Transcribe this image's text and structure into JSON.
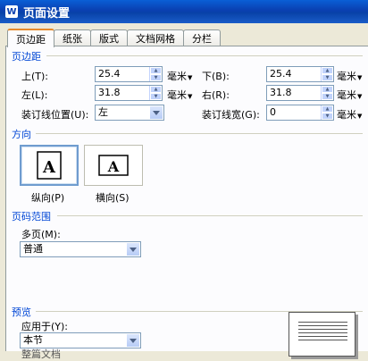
{
  "window": {
    "title": "页面设置",
    "icon_glyph": "W"
  },
  "tabs": [
    {
      "label": "页边距",
      "active": true
    },
    {
      "label": "纸张",
      "active": false
    },
    {
      "label": "版式",
      "active": false
    },
    {
      "label": "文档网格",
      "active": false
    },
    {
      "label": "分栏",
      "active": false
    }
  ],
  "margins": {
    "title": "页边距",
    "top_label": "上(T):",
    "top_value": "25.4",
    "bottom_label": "下(B):",
    "bottom_value": "25.4",
    "left_label": "左(L):",
    "left_value": "31.8",
    "right_label": "右(R):",
    "right_value": "31.8",
    "unit": "毫米",
    "gutter_pos_label": "装订线位置(U):",
    "gutter_pos_value": "左",
    "gutter_width_label": "装订线宽(G):",
    "gutter_width_value": "0"
  },
  "orientation": {
    "title": "方向",
    "icon_letter": "A",
    "portrait_label": "纵向(P)",
    "landscape_label": "横向(S)",
    "selected": "portrait"
  },
  "page_range": {
    "title": "页码范围",
    "multi_label": "多页(M):",
    "multi_value": "普通"
  },
  "preview": {
    "title": "预览",
    "apply_label": "应用于(Y):",
    "apply_value": "本节",
    "next_option_partial": "整篇文档"
  },
  "colors": {
    "section_title": "#0046d5",
    "active_tab_accent": "#e68b2c",
    "titlebar": "#0a3fb0"
  }
}
